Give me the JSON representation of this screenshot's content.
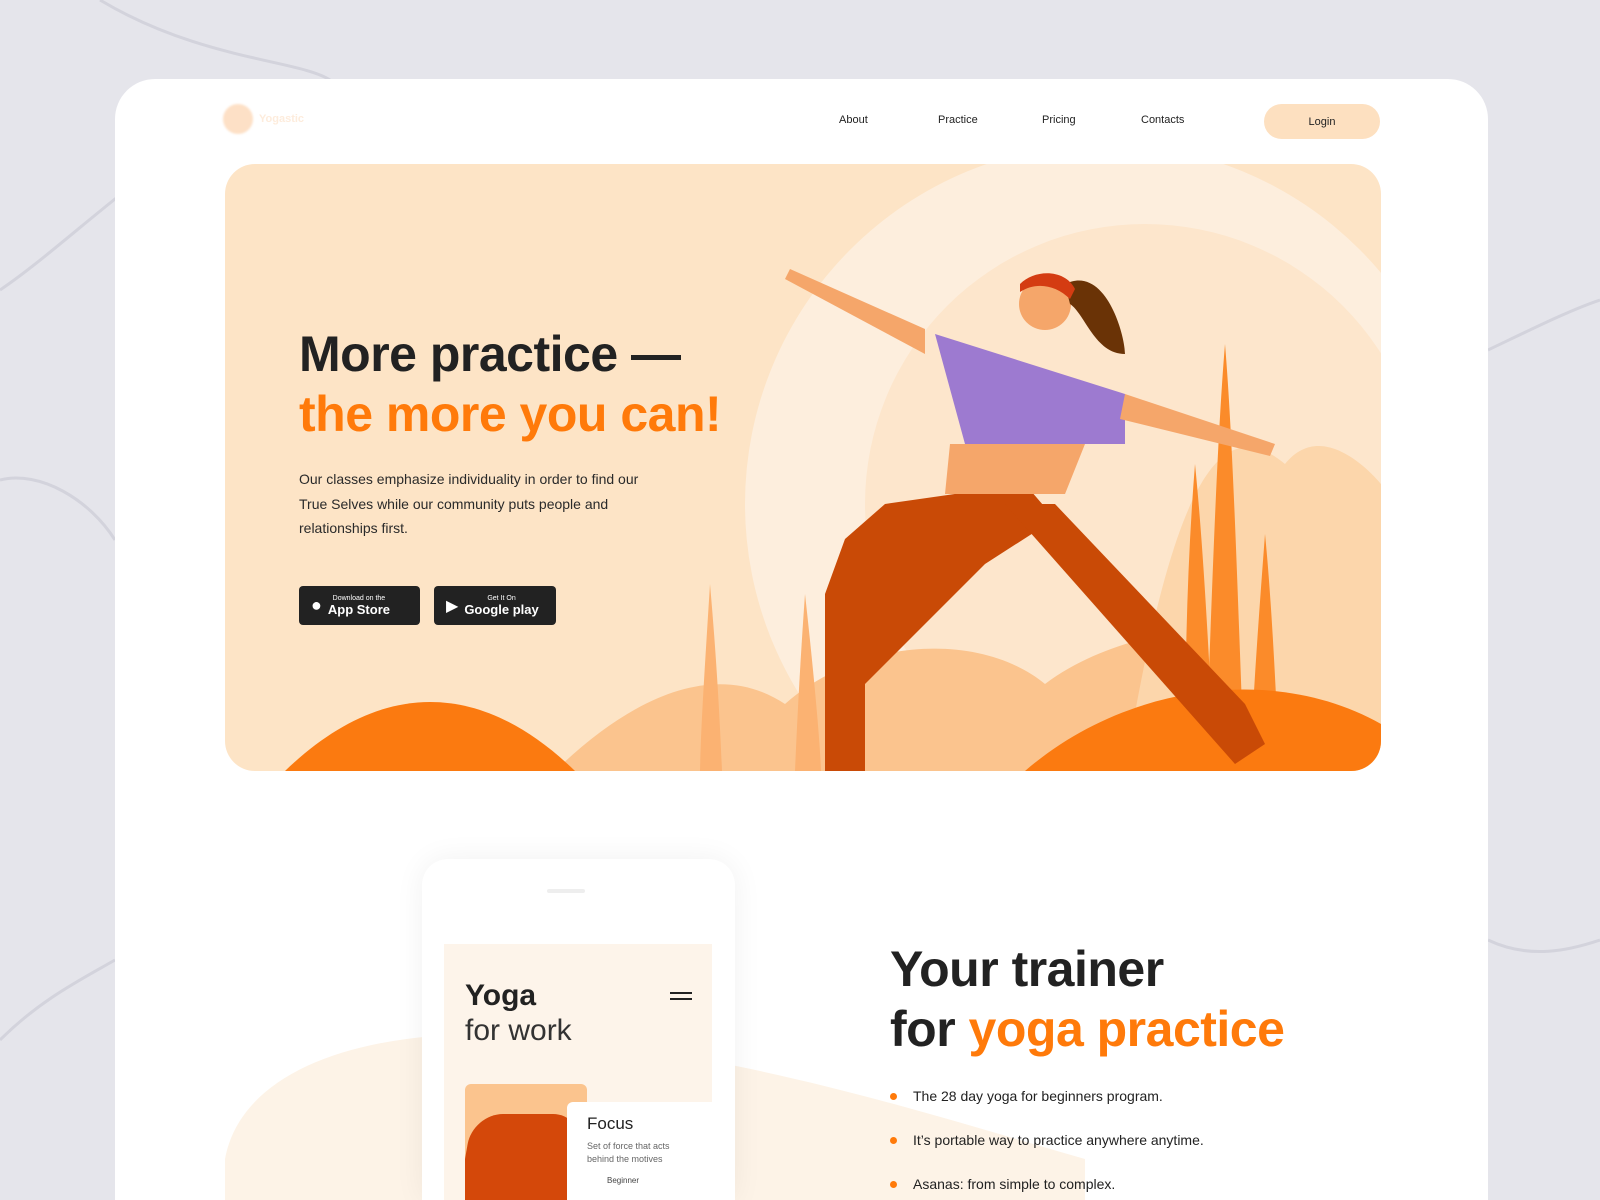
{
  "nav": {
    "logo_text": "Yogastic",
    "items": [
      "About",
      "Practice",
      "Pricing",
      "Contacts"
    ],
    "login": "Login"
  },
  "hero": {
    "title_line1": "More practice —",
    "title_line2": "the more you can!",
    "description": "Our classes emphasize individuality in order to find our True Selves while our community puts people and relationships first.",
    "app_store": {
      "small": "Download on the",
      "big": "App Store",
      "icon": "apple-icon"
    },
    "google_play": {
      "small": "Get It On",
      "big": "Google play",
      "icon": "play-icon"
    }
  },
  "phone": {
    "title_bold": "Yoga",
    "title_light": "for work",
    "card_title": "Focus",
    "card_text": "Set of force that acts behind the motives",
    "card_level": "Beginner"
  },
  "trainer": {
    "title_line1": "Your trainer",
    "title_line2_prefix": "for ",
    "title_line2_accent": "yoga practice",
    "bullets": [
      "The 28 day yoga for beginners program.",
      "It’s portable way to practice anywhere anytime.",
      "Asanas: from simple to complex."
    ]
  },
  "colors": {
    "accent": "#ff7a0a",
    "hero_bg": "#fde4c6",
    "dark": "#222222"
  }
}
